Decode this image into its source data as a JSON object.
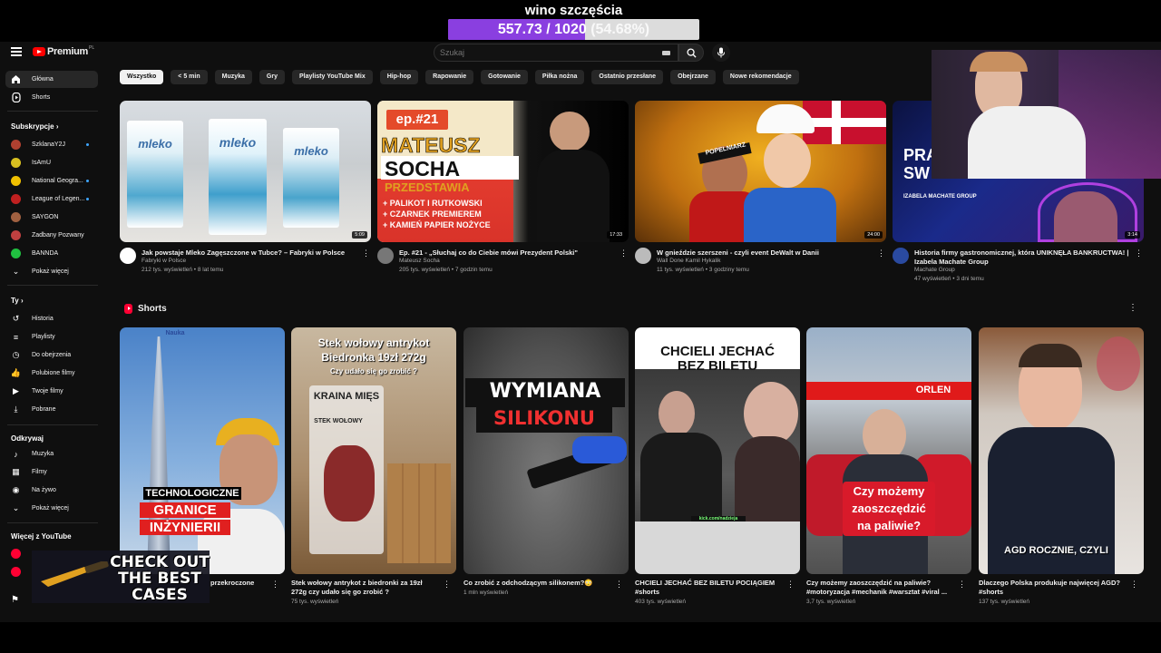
{
  "overlay": {
    "title": "wino szczęścia",
    "goal_value": "557.73 / 1020",
    "goal_percent": "(54.68%)",
    "goal_fraction": 0.5468,
    "goal_color": "#8a3fe0"
  },
  "header": {
    "logo_text": "Premium",
    "logo_region": "PL",
    "search_placeholder": "Szukaj"
  },
  "sidebar": {
    "main": [
      {
        "label": "Główna",
        "icon": "home-icon",
        "active": true
      },
      {
        "label": "Shorts",
        "icon": "shorts-icon",
        "active": false
      }
    ],
    "subscriptions_header": "Subskrypcje",
    "subscriptions": [
      {
        "label": "SzklanaY2J",
        "color": "#b04030",
        "dot": true
      },
      {
        "label": "IsAmU",
        "color": "#d8c020",
        "dot": false
      },
      {
        "label": "National Geogra...",
        "color": "#f0c000",
        "dot": true
      },
      {
        "label": "League of Legen...",
        "color": "#c02020",
        "dot": true
      },
      {
        "label": "SAYGON",
        "color": "#a06040",
        "dot": false
      },
      {
        "label": "Zadbany Pozwany",
        "color": "#c04040",
        "dot": false
      },
      {
        "label": "BANNDA",
        "color": "#20c040",
        "dot": false
      }
    ],
    "show_more": "Pokaż więcej",
    "you_header": "Ty",
    "you_items": [
      {
        "label": "Historia",
        "icon": "history-icon"
      },
      {
        "label": "Playlisty",
        "icon": "playlist-icon"
      },
      {
        "label": "Do obejrzenia",
        "icon": "clock-icon"
      },
      {
        "label": "Polubione filmy",
        "icon": "thumbs-up-icon"
      },
      {
        "label": "Twoje filmy",
        "icon": "video-icon"
      },
      {
        "label": "Pobrane",
        "icon": "download-icon"
      }
    ],
    "explore_header": "Odkrywaj",
    "explore_items": [
      {
        "label": "Muzyka",
        "icon": "music-icon"
      },
      {
        "label": "Filmy",
        "icon": "film-icon"
      },
      {
        "label": "Na żywo",
        "icon": "live-icon"
      },
      {
        "label": "Pokaż więcej",
        "icon": "chevron-down-icon"
      }
    ],
    "more_header": "Więcej z YouTube"
  },
  "chips": [
    "Wszystko",
    "< 5 min",
    "Muzyka",
    "Gry",
    "Playlisty YouTube Mix",
    "Hip-hop",
    "Rapowanie",
    "Gotowanie",
    "Piłka nożna",
    "Ostatnio przesłane",
    "Obejrzane",
    "Nowe rekomendacje"
  ],
  "videos": [
    {
      "title": "Jak powstaje Mleko Zagęszczone w Tubce? – Fabryki w Polsce",
      "channel": "Fabryki w Polsce",
      "meta": "212 tys. wyświetleń • 8 lat temu",
      "duration": "5:09",
      "thumb_text": [
        "mleko",
        "mleko",
        "mleko"
      ]
    },
    {
      "title": "Ep. #21 - „Słuchaj co do Ciebie mówi Prezydent Polski\"",
      "channel": "Mateusz Socha",
      "meta": "205 tys. wyświetleń • 7 godzin temu",
      "duration": "17:33",
      "thumb_text": [
        "ep.#21",
        "MATEUSZ",
        "SOCHA",
        "PRZEDSTAWIA",
        "+ PALIKOT I RUTKOWSKI",
        "+ CZARNEK PREMIEREM",
        "+ KAMIEŃ PAPIER NOŻYCE"
      ]
    },
    {
      "title": "W gnieździe szerszeni - czyli event DeWalt w Danii",
      "channel": "Wall Done Kamil Hykalik",
      "meta": "11 tys. wyświetleń • 3 godziny temu",
      "duration": "24:00",
      "thumb_text": [
        "POPELNIARZ"
      ]
    },
    {
      "title": "Historia firmy gastronomicznej, która UNIKNĘŁA BANKRUCTWA! | Izabela Machate Group",
      "channel": "Machate Group",
      "meta": "47 wyświetleń • 3 dni temu",
      "duration": "3:14",
      "thumb_text": [
        "PRA",
        "SW",
        "IZABELA MACHATE GROUP"
      ]
    }
  ],
  "shorts_header": "Shorts",
  "shorts": [
    {
      "title": "przekroczone",
      "views": "",
      "thumb_text": [
        "Nauka",
        "TECHNOLOGICZNE",
        "GRANICE",
        "INŻYNIERII"
      ]
    },
    {
      "title": "Stek wołowy antrykot z biedronki za 19zł 272g czy udało się go zrobić ?",
      "views": "75 tys. wyświetleń",
      "thumb_text": [
        "Stek wołowy antrykot",
        "Biedronka 19zł 272g",
        "Czy udało się go zrobić ?",
        "KRAINA MIĘS",
        "STEK WOŁOWY"
      ]
    },
    {
      "title": "Co zrobić z odchodzącym silikonem?😳",
      "views": "1 mln wyświetleń",
      "thumb_text": [
        "WYMIANA",
        "SILIKONU"
      ]
    },
    {
      "title": "CHCIELI JECHAĆ BEZ BILETU POCIĄGIEM #shorts",
      "views": "403 tys. wyświetleń",
      "thumb_text": [
        "CHCIELI JECHAĆ",
        "BEZ BILETU",
        "kick.com/nadzieja"
      ]
    },
    {
      "title": "Czy możemy zaoszczędzić na paliwie? #motoryzacja #mechanik #warsztat #viral ...",
      "views": "3,7 tys. wyświetleń",
      "thumb_text": [
        "ORLEN",
        "Czy możemy",
        "zaoszczędzić",
        "na paliwie?"
      ]
    },
    {
      "title": "Dlaczego Polska produkuje najwięcej AGD? #shorts",
      "views": "137 tys. wyświetleń",
      "thumb_text": [
        "AGD ROCZNIE, CZYLI"
      ]
    }
  ],
  "promo": {
    "text": "CHECK OUT THE BEST CASES"
  }
}
